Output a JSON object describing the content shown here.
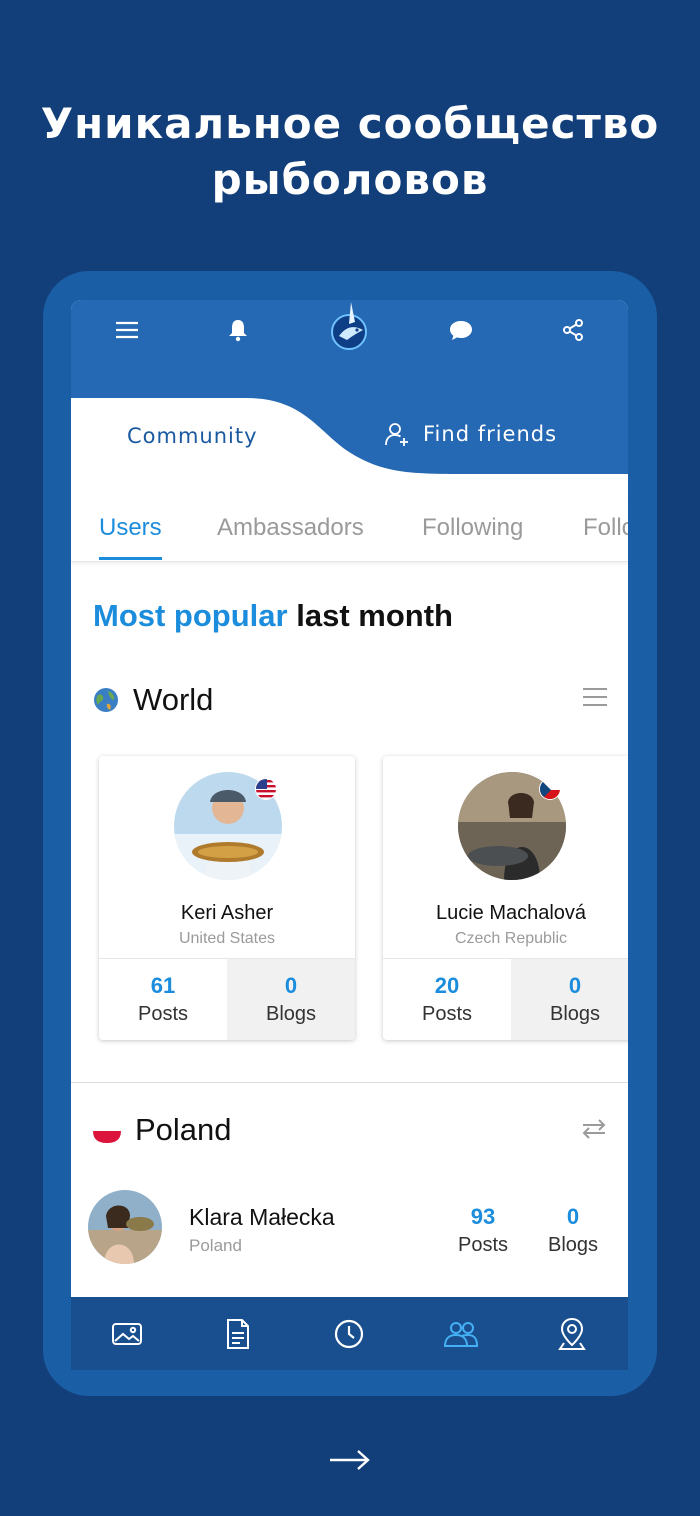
{
  "headline": {
    "line1": "Уникальное сообщество",
    "line2": "рыболовов"
  },
  "topbar": {
    "icons": [
      "menu-icon",
      "bell-icon",
      "chat-icon",
      "share-icon"
    ],
    "logo": "marlin-logo"
  },
  "main_tabs": {
    "community": "Community",
    "find_friends": "Find friends"
  },
  "subtabs": [
    "Users",
    "Ambassadors",
    "Following",
    "Follo"
  ],
  "section": {
    "highlight": "Most popular",
    "rest": "last month"
  },
  "world": {
    "name": "World",
    "users": [
      {
        "name": "Keri Asher",
        "country": "United States",
        "posts": "61",
        "posts_label": "Posts",
        "blogs": "0",
        "blogs_label": "Blogs"
      },
      {
        "name": "Lucie Machalová",
        "country": "Czech Republic",
        "posts": "20",
        "posts_label": "Posts",
        "blogs": "0",
        "blogs_label": "Blogs"
      }
    ]
  },
  "poland": {
    "name": "Poland",
    "user": {
      "name": "Klara Małecka",
      "country": "Poland",
      "posts": "93",
      "posts_label": "Posts",
      "blogs": "0",
      "blogs_label": "Blogs"
    }
  },
  "bottom_nav": [
    "gallery-icon",
    "document-icon",
    "clock-icon",
    "community-icon",
    "location-icon"
  ],
  "colors": {
    "background": "#123f7a",
    "accent": "#1c8ddc",
    "topbar": "#2568b3",
    "nav": "#194f8e"
  }
}
